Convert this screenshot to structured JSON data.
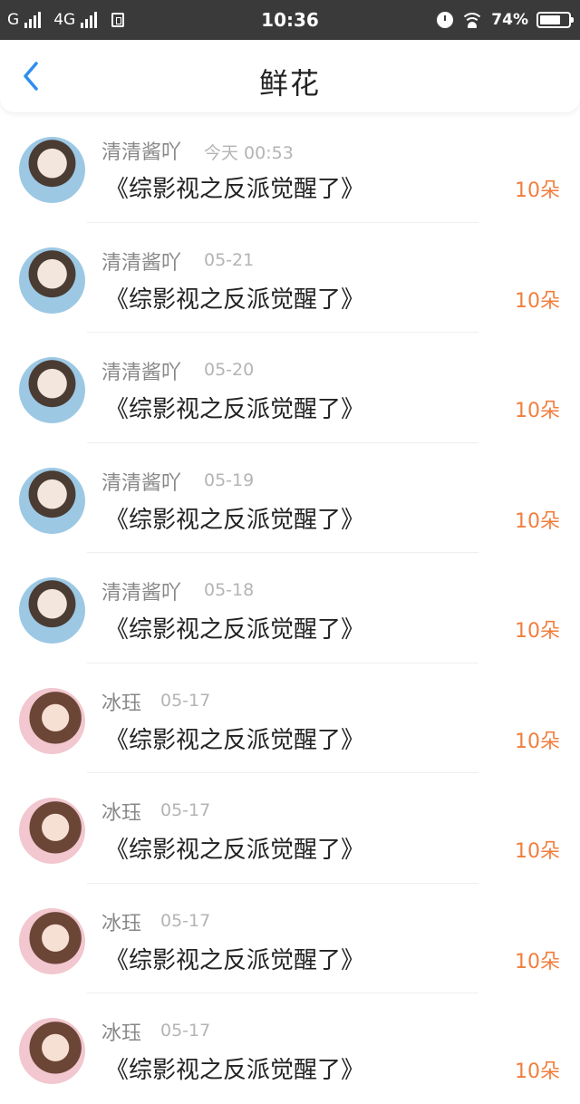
{
  "status_bar": {
    "carrier1": "G",
    "carrier2": "4G",
    "time": "10:36",
    "battery": "74%",
    "battery_level": 0.74
  },
  "header": {
    "title": "鲜花",
    "back_icon": "chevron-left-icon",
    "accent_color": "#2f8ef0"
  },
  "items": [
    {
      "name": "清清酱吖",
      "time": "今天 00:53",
      "book": "《综影视之反派觉醒了》",
      "count": "10朵"
    },
    {
      "name": "清清酱吖",
      "time": "05-21",
      "book": "《综影视之反派觉醒了》",
      "count": "10朵"
    },
    {
      "name": "清清酱吖",
      "time": "05-20",
      "book": "《综影视之反派觉醒了》",
      "count": "10朵"
    },
    {
      "name": "清清酱吖",
      "time": "05-19",
      "book": "《综影视之反派觉醒了》",
      "count": "10朵"
    },
    {
      "name": "清清酱吖",
      "time": "05-18",
      "book": "《综影视之反派觉醒了》",
      "count": "10朵"
    },
    {
      "name": "冰珏",
      "time": "05-17",
      "book": "《综影视之反派觉醒了》",
      "count": "10朵"
    },
    {
      "name": "冰珏",
      "time": "05-17",
      "book": "《综影视之反派觉醒了》",
      "count": "10朵"
    },
    {
      "name": "冰珏",
      "time": "05-17",
      "book": "《综影视之反派觉醒了》",
      "count": "10朵"
    },
    {
      "name": "冰珏",
      "time": "05-17",
      "book": "《综影视之反派觉醒了》",
      "count": "10朵"
    }
  ]
}
